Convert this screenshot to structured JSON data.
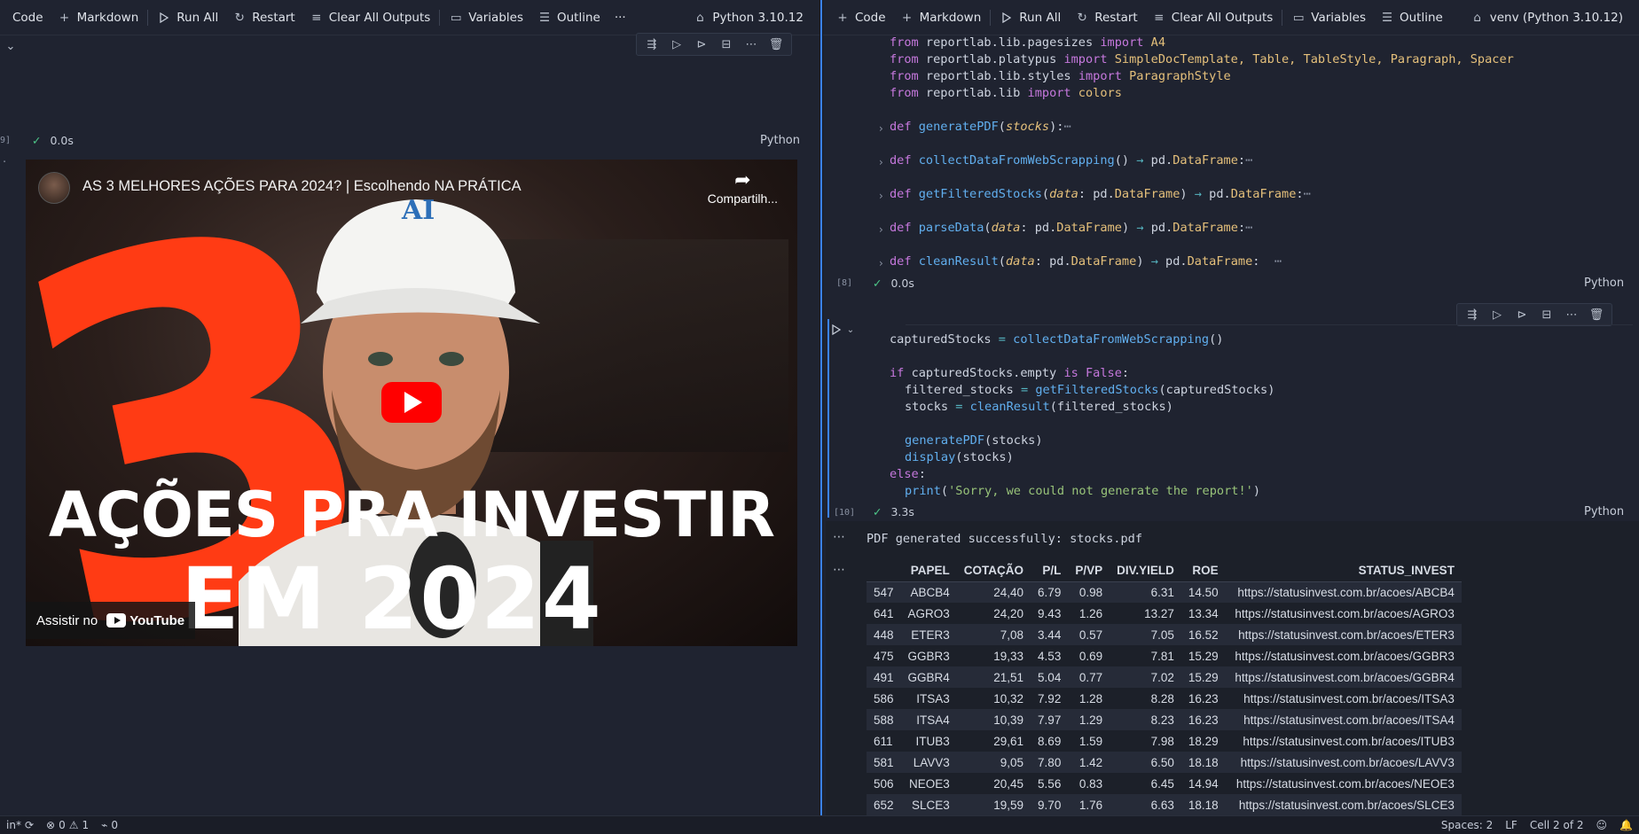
{
  "left_toolbar": {
    "code": "Code",
    "markdown": "Markdown",
    "run_all": "Run All",
    "restart": "Restart",
    "clear_outputs": "Clear All Outputs",
    "variables": "Variables",
    "outline": "Outline",
    "more": "···",
    "kernel": "Python 3.10.12"
  },
  "right_toolbar": {
    "code": "Code",
    "markdown": "Markdown",
    "run_all": "Run All",
    "restart": "Restart",
    "clear_outputs": "Clear All Outputs",
    "variables": "Variables",
    "outline": "Outline",
    "kernel": "venv (Python 3.10.12)"
  },
  "left_cell": {
    "exec_count": "9]",
    "duration": "0.0s",
    "language": "Python",
    "output_marker": "·"
  },
  "video": {
    "title": "AS 3 MELHORES AÇÕES PARA 2024? | Escolhendo NA PRÁTICA",
    "share": "Compartilh...",
    "big_number": "3",
    "headline_line1": "AÇÕES PRA INVESTIR",
    "headline_line2": "EM 2024",
    "watch_on": "Assistir no",
    "youtube": "YouTube",
    "cap_text": "AI"
  },
  "right_cell1": {
    "imports": [
      [
        "from",
        "reportlab.lib.pagesizes",
        "import",
        "A4"
      ],
      [
        "from",
        "reportlab.platypus",
        "import",
        "SimpleDocTemplate, Table, TableStyle, Paragraph, Spacer"
      ],
      [
        "from",
        "reportlab.lib.styles",
        "import",
        "ParagraphStyle"
      ],
      [
        "from",
        "reportlab.lib",
        "import",
        "colors"
      ]
    ],
    "exec_count": "[8]",
    "duration": "0.0s",
    "language": "Python"
  },
  "right_cell2": {
    "line1_var": "capturedStocks",
    "line1_fn": "collectDataFromWebScrapping",
    "line2_var": "capturedStocks.empty",
    "line2_kw": "is",
    "line2_val": "False",
    "line3_var": "filtered_stocks",
    "line3_fn": "getFilteredStocks",
    "line3_arg": "capturedStocks",
    "line4_var": "stocks",
    "line4_fn": "cleanResult",
    "line4_arg": "filtered_stocks",
    "line5_fn": "generatePDF",
    "line5_arg": "stocks",
    "line6_fn": "display",
    "line6_arg": "stocks",
    "line7_kw": "else",
    "line8_fn": "print",
    "line8_str": "'Sorry, we could not generate the report!'",
    "exec_count": "[10]",
    "duration": "3.3s",
    "language": "Python"
  },
  "output": {
    "message": "PDF generated successfully: stocks.pdf",
    "columns": [
      "",
      "PAPEL",
      "COTAÇÃO",
      "P/L",
      "P/VP",
      "DIV.YIELD",
      "ROE",
      "STATUS_INVEST"
    ],
    "rows": [
      [
        "547",
        "ABCB4",
        "24,40",
        "6.79",
        "0.98",
        "6.31",
        "14.50",
        "https://statusinvest.com.br/acoes/ABCB4"
      ],
      [
        "641",
        "AGRO3",
        "24,20",
        "9.43",
        "1.26",
        "13.27",
        "13.34",
        "https://statusinvest.com.br/acoes/AGRO3"
      ],
      [
        "448",
        "ETER3",
        "7,08",
        "3.44",
        "0.57",
        "7.05",
        "16.52",
        "https://statusinvest.com.br/acoes/ETER3"
      ],
      [
        "475",
        "GGBR3",
        "19,33",
        "4.53",
        "0.69",
        "7.81",
        "15.29",
        "https://statusinvest.com.br/acoes/GGBR3"
      ],
      [
        "491",
        "GGBR4",
        "21,51",
        "5.04",
        "0.77",
        "7.02",
        "15.29",
        "https://statusinvest.com.br/acoes/GGBR4"
      ],
      [
        "586",
        "ITSA3",
        "10,32",
        "7.92",
        "1.28",
        "8.28",
        "16.23",
        "https://statusinvest.com.br/acoes/ITSA3"
      ],
      [
        "588",
        "ITSA4",
        "10,39",
        "7.97",
        "1.29",
        "8.23",
        "16.23",
        "https://statusinvest.com.br/acoes/ITSA4"
      ],
      [
        "611",
        "ITUB3",
        "29,61",
        "8.69",
        "1.59",
        "7.98",
        "18.29",
        "https://statusinvest.com.br/acoes/ITUB3"
      ],
      [
        "581",
        "LAVV3",
        "9,05",
        "7.80",
        "1.42",
        "6.50",
        "18.18",
        "https://statusinvest.com.br/acoes/LAVV3"
      ],
      [
        "506",
        "NEOE3",
        "20,45",
        "5.56",
        "0.83",
        "6.45",
        "14.94",
        "https://statusinvest.com.br/acoes/NEOE3"
      ],
      [
        "652",
        "SLCE3",
        "19,59",
        "9.70",
        "1.76",
        "6.63",
        "18.18",
        "https://statusinvest.com.br/acoes/SLCE3"
      ]
    ]
  },
  "statusbar": {
    "left_text": "in*",
    "errors": "0",
    "warnings": "1",
    "ports": "0",
    "spaces": "Spaces: 2",
    "eol": "LF",
    "cell_pos": "Cell 2 of 2"
  },
  "colors": {
    "accent": "#3b82f6",
    "success": "#4ec98a",
    "youtube_red": "#ff0000",
    "thumbnail_orange": "#ff3b14"
  }
}
